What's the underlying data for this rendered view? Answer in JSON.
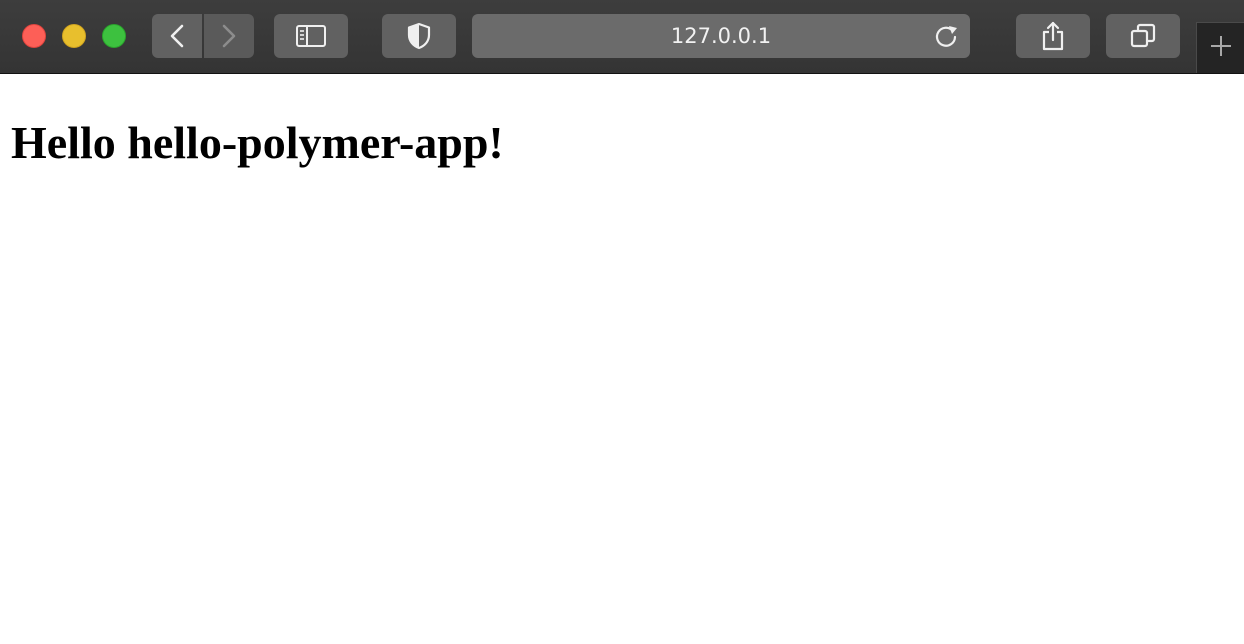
{
  "browser": {
    "address_bar": {
      "url": "127.0.0.1"
    },
    "icons": {
      "close": "close-icon",
      "minimize": "minimize-icon",
      "zoom": "zoom-icon",
      "back": "chevron-left-icon",
      "forward": "chevron-right-icon",
      "sidebar": "sidebar-icon",
      "privacy": "shield-icon",
      "reload": "reload-icon",
      "share": "share-icon",
      "tabs": "tab-overview-icon",
      "new_tab": "plus-icon"
    },
    "colors": {
      "toolbar": "#3a3a3a",
      "close": "#fd5f57",
      "minimize": "#e8bf2d",
      "zoom": "#3dc13f"
    }
  },
  "page": {
    "heading": "Hello hello-polymer-app!"
  }
}
